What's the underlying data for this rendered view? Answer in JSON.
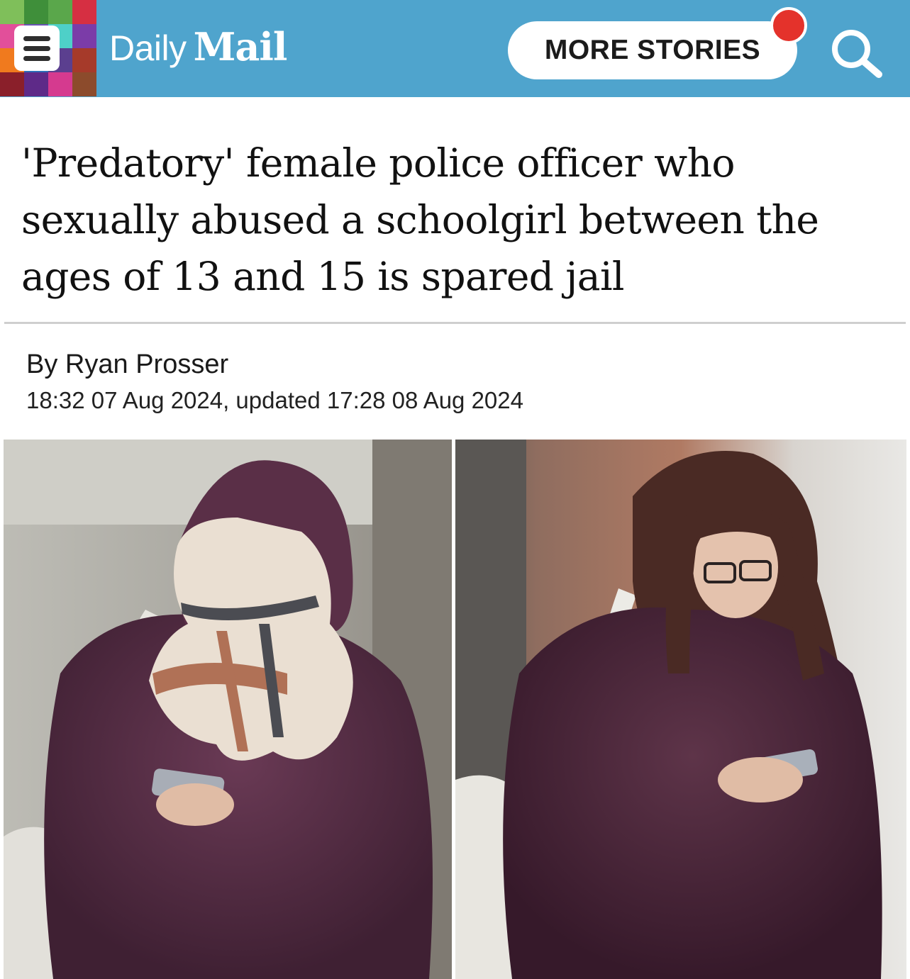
{
  "header": {
    "logo_daily": "Daily",
    "logo_mail": "Mail",
    "more_stories_label": "MORE STORIES",
    "menu_icon": "hamburger-menu-icon",
    "search_icon": "search-icon",
    "colors": {
      "bar": "#4fa4cd",
      "notification": "#e4322b"
    }
  },
  "article": {
    "headline": "'Predatory' female police officer who sexually abused a schoolgirl between the ages of 13 and 15 is spared jail",
    "byline_prefix": "By",
    "author": "Ryan Prosser",
    "timestamp": "18:32 07 Aug 2024, updated 17:28 08 Aug 2024"
  }
}
